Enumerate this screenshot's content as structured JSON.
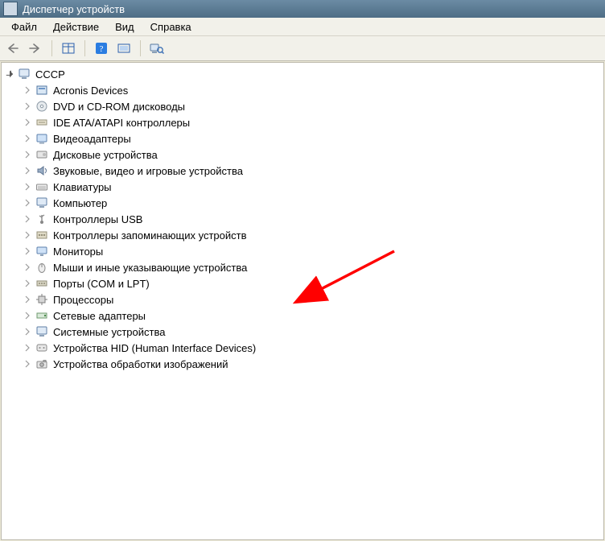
{
  "window": {
    "title": "Диспетчер устройств"
  },
  "menu": {
    "file": "Файл",
    "action": "Действие",
    "view": "Вид",
    "help": "Справка"
  },
  "tree": {
    "root": "СССР",
    "items": [
      "Acronis Devices",
      "DVD и CD-ROM дисководы",
      "IDE ATA/ATAPI контроллеры",
      "Видеоадаптеры",
      "Дисковые устройства",
      "Звуковые, видео и игровые устройства",
      "Клавиатуры",
      "Компьютер",
      "Контроллеры USB",
      "Контроллеры запоминающих устройств",
      "Мониторы",
      "Мыши и иные указывающие устройства",
      "Порты (COM и LPT)",
      "Процессоры",
      "Сетевые адаптеры",
      "Системные устройства",
      "Устройства HID (Human Interface Devices)",
      "Устройства обработки изображений"
    ]
  }
}
